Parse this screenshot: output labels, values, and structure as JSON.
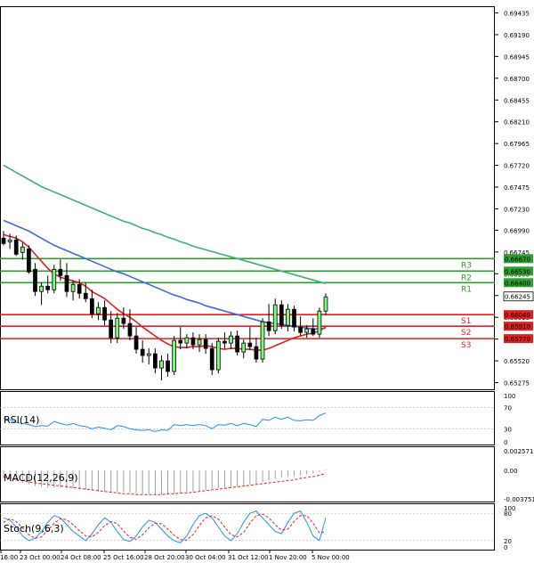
{
  "chart_data": [
    {
      "type": "candlestick",
      "pane": "price",
      "ylim": [
        0.652,
        0.695
      ],
      "y_ticks": [
        "0.69435",
        "0.69190",
        "0.68945",
        "0.68700",
        "0.68455",
        "0.68210",
        "0.67965",
        "0.67720",
        "0.67475",
        "0.67230",
        "0.66990",
        "0.66745",
        "0.66500",
        "0.66255",
        "0.66010",
        "0.65765",
        "0.65520",
        "0.65275"
      ],
      "current_price": {
        "label": "0.66245",
        "value": 0.66245
      },
      "levels": [
        {
          "name": "R3",
          "label": "0.66670",
          "value": 0.6667,
          "color": "#2e9e2e"
        },
        {
          "name": "R2",
          "label": "0.66530",
          "value": 0.6653,
          "color": "#2e9e2e"
        },
        {
          "name": "R1",
          "label": "0.66400",
          "value": 0.664,
          "color": "#2e9e2e"
        },
        {
          "name": "S1",
          "label": "0.66040",
          "value": 0.6604,
          "color": "#e02020"
        },
        {
          "name": "S2",
          "label": "0.65910",
          "value": 0.6591,
          "color": "#e02020"
        },
        {
          "name": "S3",
          "label": "0.65770",
          "value": 0.6577,
          "color": "#e02020"
        }
      ],
      "candles": [
        {
          "o": 0.669,
          "h": 0.6698,
          "l": 0.6682,
          "c": 0.6684
        },
        {
          "o": 0.6686,
          "h": 0.6695,
          "l": 0.6678,
          "c": 0.6688
        },
        {
          "o": 0.6688,
          "h": 0.6693,
          "l": 0.667,
          "c": 0.6672
        },
        {
          "o": 0.6674,
          "h": 0.6685,
          "l": 0.6666,
          "c": 0.668
        },
        {
          "o": 0.6678,
          "h": 0.6682,
          "l": 0.665,
          "c": 0.6652
        },
        {
          "o": 0.6655,
          "h": 0.6662,
          "l": 0.6625,
          "c": 0.663
        },
        {
          "o": 0.663,
          "h": 0.664,
          "l": 0.6615,
          "c": 0.6636
        },
        {
          "o": 0.6636,
          "h": 0.6648,
          "l": 0.6628,
          "c": 0.6632
        },
        {
          "o": 0.6632,
          "h": 0.666,
          "l": 0.6628,
          "c": 0.6655
        },
        {
          "o": 0.6655,
          "h": 0.6666,
          "l": 0.6642,
          "c": 0.6648
        },
        {
          "o": 0.6648,
          "h": 0.6662,
          "l": 0.6624,
          "c": 0.663
        },
        {
          "o": 0.663,
          "h": 0.6642,
          "l": 0.662,
          "c": 0.6638
        },
        {
          "o": 0.6638,
          "h": 0.6644,
          "l": 0.6622,
          "c": 0.6628
        },
        {
          "o": 0.6628,
          "h": 0.664,
          "l": 0.6618,
          "c": 0.6622
        },
        {
          "o": 0.6622,
          "h": 0.6632,
          "l": 0.66,
          "c": 0.6605
        },
        {
          "o": 0.6605,
          "h": 0.6618,
          "l": 0.6598,
          "c": 0.6612
        },
        {
          "o": 0.6612,
          "h": 0.662,
          "l": 0.6592,
          "c": 0.6598
        },
        {
          "o": 0.6598,
          "h": 0.6608,
          "l": 0.6572,
          "c": 0.6578
        },
        {
          "o": 0.6578,
          "h": 0.6606,
          "l": 0.6572,
          "c": 0.66
        },
        {
          "o": 0.66,
          "h": 0.6612,
          "l": 0.6588,
          "c": 0.6594
        },
        {
          "o": 0.6594,
          "h": 0.661,
          "l": 0.6575,
          "c": 0.658
        },
        {
          "o": 0.658,
          "h": 0.659,
          "l": 0.656,
          "c": 0.6565
        },
        {
          "o": 0.6565,
          "h": 0.6575,
          "l": 0.655,
          "c": 0.6558
        },
        {
          "o": 0.6558,
          "h": 0.6566,
          "l": 0.6548,
          "c": 0.656
        },
        {
          "o": 0.656,
          "h": 0.6566,
          "l": 0.6538,
          "c": 0.6544
        },
        {
          "o": 0.6544,
          "h": 0.6558,
          "l": 0.653,
          "c": 0.6552
        },
        {
          "o": 0.6552,
          "h": 0.656,
          "l": 0.6534,
          "c": 0.654
        },
        {
          "o": 0.654,
          "h": 0.658,
          "l": 0.6536,
          "c": 0.6575
        },
        {
          "o": 0.6575,
          "h": 0.659,
          "l": 0.6565,
          "c": 0.6572
        },
        {
          "o": 0.6572,
          "h": 0.6582,
          "l": 0.6566,
          "c": 0.6578
        },
        {
          "o": 0.6578,
          "h": 0.6584,
          "l": 0.6565,
          "c": 0.657
        },
        {
          "o": 0.657,
          "h": 0.6582,
          "l": 0.6562,
          "c": 0.6576
        },
        {
          "o": 0.6576,
          "h": 0.6582,
          "l": 0.656,
          "c": 0.6566
        },
        {
          "o": 0.6566,
          "h": 0.6572,
          "l": 0.6536,
          "c": 0.6542
        },
        {
          "o": 0.6542,
          "h": 0.6578,
          "l": 0.6538,
          "c": 0.6574
        },
        {
          "o": 0.6574,
          "h": 0.6584,
          "l": 0.6566,
          "c": 0.6572
        },
        {
          "o": 0.6572,
          "h": 0.6585,
          "l": 0.6565,
          "c": 0.658
        },
        {
          "o": 0.658,
          "h": 0.6586,
          "l": 0.6558,
          "c": 0.6562
        },
        {
          "o": 0.6562,
          "h": 0.6576,
          "l": 0.6555,
          "c": 0.6572
        },
        {
          "o": 0.6572,
          "h": 0.659,
          "l": 0.6564,
          "c": 0.6568
        },
        {
          "o": 0.6568,
          "h": 0.6578,
          "l": 0.655,
          "c": 0.6554
        },
        {
          "o": 0.6554,
          "h": 0.66,
          "l": 0.655,
          "c": 0.6596
        },
        {
          "o": 0.6596,
          "h": 0.6616,
          "l": 0.658,
          "c": 0.6586
        },
        {
          "o": 0.6586,
          "h": 0.6622,
          "l": 0.6582,
          "c": 0.6615
        },
        {
          "o": 0.6615,
          "h": 0.662,
          "l": 0.6588,
          "c": 0.6592
        },
        {
          "o": 0.6592,
          "h": 0.6616,
          "l": 0.6585,
          "c": 0.661
        },
        {
          "o": 0.661,
          "h": 0.6614,
          "l": 0.6585,
          "c": 0.659
        },
        {
          "o": 0.659,
          "h": 0.6602,
          "l": 0.658,
          "c": 0.6584
        },
        {
          "o": 0.6584,
          "h": 0.6592,
          "l": 0.6578,
          "c": 0.6588
        },
        {
          "o": 0.6588,
          "h": 0.66,
          "l": 0.658,
          "c": 0.6582
        },
        {
          "o": 0.6582,
          "h": 0.6612,
          "l": 0.6578,
          "c": 0.6608
        },
        {
          "o": 0.6608,
          "h": 0.6628,
          "l": 0.6604,
          "c": 0.6624
        }
      ],
      "ma_green": [
        0.6772,
        0.6768,
        0.6764,
        0.676,
        0.6756,
        0.6752,
        0.6748,
        0.6745,
        0.6742,
        0.6739,
        0.6736,
        0.6733,
        0.673,
        0.6727,
        0.6724,
        0.6721,
        0.6718,
        0.6715,
        0.6712,
        0.6709,
        0.6707,
        0.6704,
        0.6701,
        0.6699,
        0.6696,
        0.6694,
        0.6691,
        0.6689,
        0.6686,
        0.6684,
        0.6681,
        0.6679,
        0.6677,
        0.6675,
        0.6673,
        0.6671,
        0.6669,
        0.6667,
        0.6665,
        0.6663,
        0.6661,
        0.6659,
        0.6657,
        0.6655,
        0.6653,
        0.6651,
        0.6649,
        0.6647,
        0.6645,
        0.6643,
        0.6641,
        0.6639
      ],
      "ma_blue": [
        0.671,
        0.6707,
        0.6704,
        0.6701,
        0.6698,
        0.6694,
        0.669,
        0.6686,
        0.6682,
        0.6679,
        0.6676,
        0.6673,
        0.667,
        0.6667,
        0.6664,
        0.6661,
        0.6658,
        0.6655,
        0.6652,
        0.665,
        0.6647,
        0.6644,
        0.6641,
        0.6638,
        0.6635,
        0.6632,
        0.6629,
        0.6626,
        0.6624,
        0.6621,
        0.6619,
        0.6617,
        0.6614,
        0.6612,
        0.661,
        0.6608,
        0.6606,
        0.6604,
        0.6602,
        0.66,
        0.6598,
        0.6596,
        0.6595,
        0.6594,
        0.6593,
        0.6592,
        0.6591,
        0.659,
        0.6589,
        0.6588,
        0.6588,
        0.6589
      ],
      "ma_red": [
        0.6694,
        0.6692,
        0.669,
        0.6686,
        0.668,
        0.6672,
        0.6664,
        0.6656,
        0.665,
        0.6646,
        0.6644,
        0.6642,
        0.664,
        0.6636,
        0.663,
        0.6626,
        0.6622,
        0.6616,
        0.661,
        0.6605,
        0.6601,
        0.6596,
        0.659,
        0.6585,
        0.658,
        0.6575,
        0.6571,
        0.6568,
        0.6567,
        0.6567,
        0.6568,
        0.6568,
        0.6569,
        0.6568,
        0.6566,
        0.6565,
        0.6566,
        0.6566,
        0.6565,
        0.6565,
        0.6564,
        0.6564,
        0.6566,
        0.6569,
        0.6572,
        0.6575,
        0.6578,
        0.658,
        0.6582,
        0.6583,
        0.6586,
        0.659
      ]
    },
    {
      "type": "line",
      "pane": "rsi",
      "title": "RSI(14)",
      "ylim": [
        0,
        100
      ],
      "y_ticks": [
        "100",
        "70",
        "30",
        "0"
      ],
      "series": [
        {
          "color": "#1e90ff",
          "values": [
            50,
            47,
            42,
            40,
            38,
            34,
            36,
            35,
            44,
            40,
            37,
            40,
            36,
            34,
            30,
            33,
            31,
            28,
            36,
            34,
            30,
            28,
            27,
            28,
            25,
            28,
            27,
            38,
            36,
            38,
            36,
            38,
            36,
            30,
            38,
            37,
            40,
            36,
            40,
            38,
            34,
            48,
            46,
            52,
            48,
            52,
            46,
            45,
            47,
            46,
            55,
            60
          ]
        }
      ]
    },
    {
      "type": "bar",
      "pane": "macd",
      "title": "MACD(12,26,9)",
      "ylim": [
        -0.004,
        0.003
      ],
      "y_ticks": [
        "0.002571",
        "0.00",
        "-0.003751"
      ],
      "histogram": [
        -0.001,
        -0.0012,
        -0.0014,
        -0.0016,
        -0.0018,
        -0.002,
        -0.0021,
        -0.0022,
        -0.0022,
        -0.0022,
        -0.0023,
        -0.0023,
        -0.0024,
        -0.0025,
        -0.0026,
        -0.0027,
        -0.0027,
        -0.0028,
        -0.0028,
        -0.0028,
        -0.0029,
        -0.003,
        -0.003,
        -0.003,
        -0.0031,
        -0.0031,
        -0.0031,
        -0.003,
        -0.0029,
        -0.0028,
        -0.0027,
        -0.0026,
        -0.0025,
        -0.0024,
        -0.0023,
        -0.0022,
        -0.0021,
        -0.002,
        -0.0019,
        -0.0018,
        -0.0017,
        -0.0015,
        -0.0013,
        -0.0011,
        -0.0009,
        -0.0008,
        -0.0007,
        -0.0006,
        -0.0005,
        -0.0004,
        -0.0002,
        0.0001
      ],
      "signal": [
        -0.0008,
        -0.001,
        -0.0012,
        -0.0013,
        -0.0015,
        -0.0016,
        -0.0017,
        -0.0018,
        -0.0019,
        -0.002,
        -0.0021,
        -0.0022,
        -0.0023,
        -0.0024,
        -0.0025,
        -0.0026,
        -0.0027,
        -0.0028,
        -0.0029,
        -0.003,
        -0.003,
        -0.0031,
        -0.0031,
        -0.0031,
        -0.0031,
        -0.0031,
        -0.003,
        -0.003,
        -0.0029,
        -0.0029,
        -0.0028,
        -0.0027,
        -0.0026,
        -0.0025,
        -0.0024,
        -0.0023,
        -0.0022,
        -0.0021,
        -0.002,
        -0.0019,
        -0.0018,
        -0.0017,
        -0.0016,
        -0.0015,
        -0.0014,
        -0.0013,
        -0.0012,
        -0.001,
        -0.0009,
        -0.0008,
        -0.0006,
        -0.0004
      ]
    },
    {
      "type": "line",
      "pane": "stoch",
      "title": "Stoch(9,6,3)",
      "ylim": [
        0,
        100
      ],
      "y_ticks": [
        "100",
        "80",
        "20",
        "0"
      ],
      "series": [
        {
          "color": "#1e90ff",
          "values": [
            70,
            65,
            50,
            30,
            20,
            25,
            40,
            60,
            75,
            70,
            55,
            40,
            30,
            20,
            35,
            55,
            70,
            60,
            40,
            22,
            18,
            30,
            50,
            65,
            60,
            45,
            30,
            20,
            15,
            30,
            55,
            75,
            80,
            70,
            50,
            30,
            20,
            35,
            60,
            80,
            85,
            70,
            55,
            40,
            35,
            60,
            80,
            85,
            60,
            30,
            20,
            70
          ]
        },
        {
          "color": "#e02020",
          "values": [
            60,
            68,
            62,
            48,
            33,
            25,
            28,
            42,
            58,
            68,
            66,
            55,
            42,
            30,
            28,
            38,
            53,
            62,
            57,
            41,
            27,
            23,
            33,
            48,
            58,
            57,
            45,
            32,
            22,
            21,
            33,
            53,
            70,
            75,
            67,
            50,
            33,
            28,
            38,
            58,
            75,
            78,
            70,
            55,
            43,
            45,
            62,
            75,
            75,
            58,
            37,
            40
          ]
        }
      ]
    }
  ],
  "x_labels": [
    "16:00",
    "23 Oct 00:00",
    "24 Oct 08:00",
    "25 Oct 16:00",
    "28 Oct 20:00",
    "30 Oct 04:00",
    "31 Oct 12:00",
    "1 Nov 20:00",
    "5 Nov 00:00"
  ]
}
